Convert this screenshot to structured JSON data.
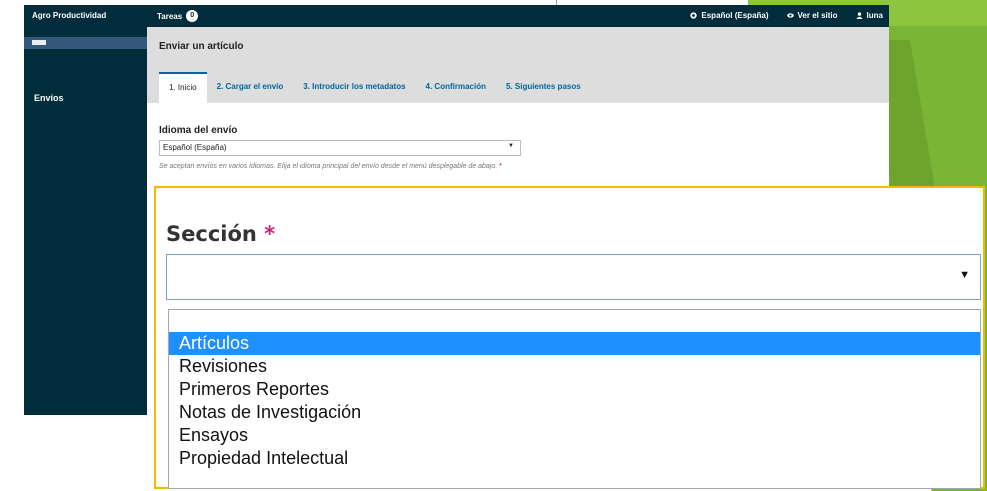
{
  "topbar": {
    "brand": "Agro Productividad",
    "tasks_label": "Tareas",
    "tasks_count": "0",
    "language": "Español (España)",
    "view_site": "Ver el sitio",
    "user": "luna"
  },
  "sidebar": {
    "items": [
      {
        "label": "Envíos"
      }
    ]
  },
  "page": {
    "title": "Enviar un artículo",
    "tabs": [
      {
        "label": "1. Inicio",
        "active": true
      },
      {
        "label": "2. Cargar el envío",
        "active": false
      },
      {
        "label": "3. Introducir los metadatos",
        "active": false
      },
      {
        "label": "4. Confirmación",
        "active": false
      },
      {
        "label": "5. Siguientes pasos",
        "active": false
      }
    ]
  },
  "form": {
    "language_label": "Idioma del envío",
    "language_value": "Español (España)",
    "language_help": "Se aceptan envíos en varios idiomas. Elija el idioma principal del envío desde el menú desplegable de abajo.",
    "required_mark": "*"
  },
  "zoom": {
    "section_label": "Sección",
    "required_mark": "*",
    "section_value": "",
    "options": [
      {
        "label": "Artículos",
        "selected": true
      },
      {
        "label": "Revisiones",
        "selected": false
      },
      {
        "label": "Primeros Reportes",
        "selected": false
      },
      {
        "label": "Notas de Investigación",
        "selected": false
      },
      {
        "label": "Ensayos",
        "selected": false
      },
      {
        "label": "Propiedad Intelectual",
        "selected": false
      }
    ]
  },
  "colors": {
    "topbar": "#002c3b",
    "accent": "#006798",
    "highlight": "#1e90ff",
    "callout_border": "#f5b800",
    "decor_green": "#7ab535"
  }
}
